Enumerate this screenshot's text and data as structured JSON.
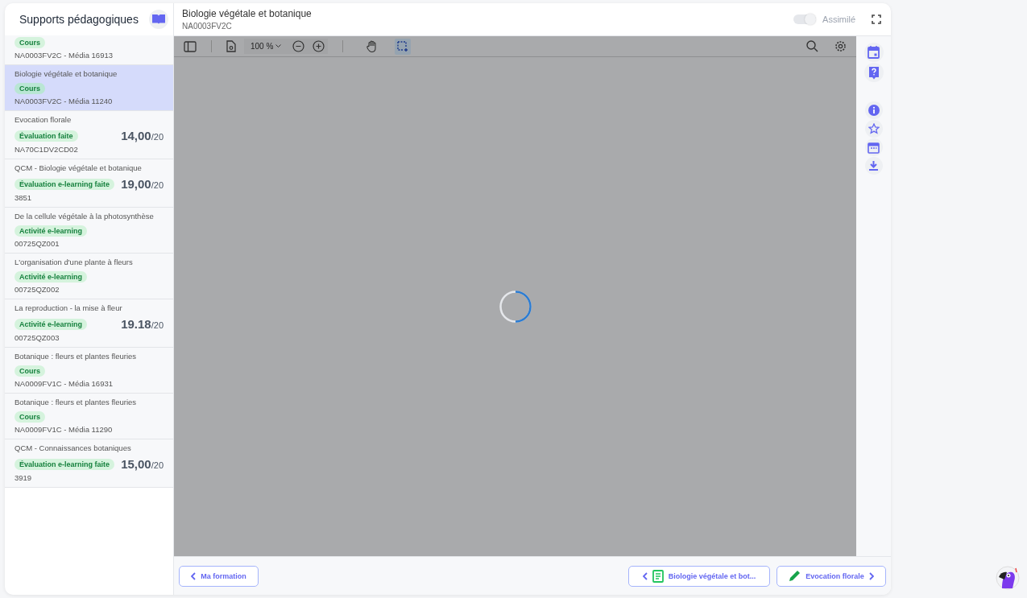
{
  "sidebar": {
    "title": "Supports pédagogiques",
    "items": [
      {
        "badge": "Cours",
        "code": "NA0003FV2C - Média 16913",
        "selected": false
      },
      {
        "title": "Biologie végétale et botanique",
        "badge": "Cours",
        "code": "NA0003FV2C - Média 11240",
        "selected": true
      },
      {
        "title": "Evocation florale",
        "badge": "Évaluation faite",
        "code": "NA70C1DV2CD02",
        "score": "14,00",
        "max": "/20",
        "selected": false
      },
      {
        "title": "QCM - Biologie végétale et botanique",
        "badge": "Évaluation e-learning faite",
        "code": "3851",
        "score": "19,00",
        "max": "/20",
        "selected": false
      },
      {
        "title": "De la cellule végétale à la photosynthèse",
        "badge": "Activité e-learning",
        "code": "00725QZ001",
        "selected": false
      },
      {
        "title": "L'organisation d'une plante à fleurs",
        "badge": "Activité e-learning",
        "code": "00725QZ002",
        "selected": false
      },
      {
        "title": "La reproduction - la mise à fleur",
        "badge": "Activité e-learning",
        "code": "00725QZ003",
        "score": "19.18",
        "max": "/20",
        "selected": false
      },
      {
        "title": "Botanique : fleurs et plantes fleuries",
        "badge": "Cours",
        "code": "NA0009FV1C - Média 16931",
        "selected": false
      },
      {
        "title": "Botanique : fleurs et plantes fleuries",
        "badge": "Cours",
        "code": "NA0009FV1C - Média 11290",
        "selected": false
      },
      {
        "title": "QCM - Connaissances botaniques",
        "badge": "Évaluation e-learning faite",
        "code": "3919",
        "score": "15,00",
        "max": "/20",
        "selected": false
      }
    ]
  },
  "header": {
    "title": "Biologie végétale et botanique",
    "subtitle": "NA0003FV2C",
    "toggle": {
      "label": "Assimilé",
      "on": true
    }
  },
  "toolbar": {
    "zoom": "100 %",
    "tools": [
      {
        "kind": "hand",
        "selected": false
      },
      {
        "kind": "select",
        "selected": true
      }
    ]
  },
  "footer": {
    "back": "Ma formation",
    "previous": "Biologie végétale et bot...",
    "next": "Evocation florale"
  }
}
